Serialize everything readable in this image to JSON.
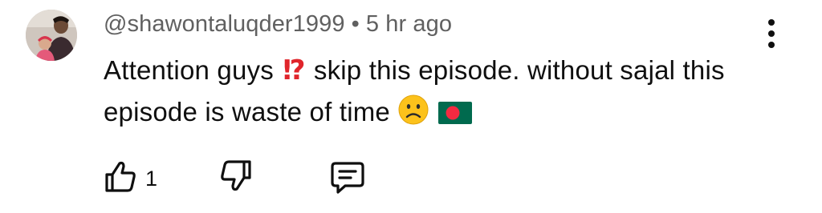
{
  "comment": {
    "author": "@shawontaluqder1999",
    "separator": "•",
    "time_ago": "5 hr ago",
    "text_part1": "Attention guys",
    "emoji1": "⁉",
    "text_part2": "skip this episode. without sajal this episode is waste of time",
    "emoji2_icon": "frowning-face-icon",
    "emoji3_icon": "bangladesh-flag-icon",
    "like_count": "1"
  },
  "icons": {
    "avatar": "avatar",
    "more": "more-vertical-icon",
    "like": "thumbs-up-icon",
    "dislike": "thumbs-down-icon",
    "reply": "comment-icon"
  },
  "colors": {
    "meta_text": "#606060",
    "body_text": "#0f0f0f",
    "flag_green": "#006a4e",
    "flag_red": "#f42a41"
  }
}
